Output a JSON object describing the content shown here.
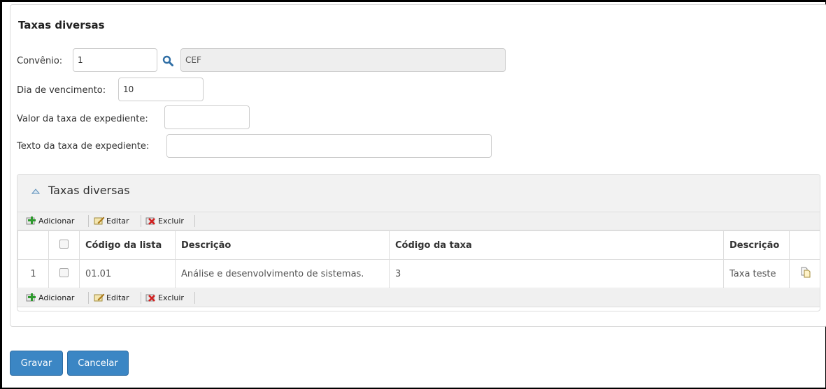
{
  "form": {
    "title": "Taxas diversas",
    "convenio_label": "Convênio:",
    "convenio_value": "1",
    "convenio_name": "CEF",
    "dia_label": "Dia de vencimento:",
    "dia_value": "10",
    "valor_label": "Valor da taxa de expediente:",
    "valor_value": "",
    "texto_label": "Texto da taxa de expediente:",
    "texto_value": ""
  },
  "grid": {
    "title": "Taxas diversas",
    "toolbar": {
      "add": "Adicionar",
      "edit": "Editar",
      "delete": "Excluir"
    },
    "columns": [
      "",
      "",
      "Código da lista",
      "Descrição",
      "Código da taxa",
      "Descrição",
      ""
    ],
    "rows": [
      {
        "num": "1",
        "codigo_lista": "01.01",
        "descricao": "Análise e desenvolvimento de sistemas.",
        "codigo_taxa": "3",
        "descricao_taxa": "Taxa teste"
      }
    ]
  },
  "actions": {
    "save": "Gravar",
    "cancel": "Cancelar"
  },
  "colors": {
    "primary": "#3b86c4",
    "header_bg": "#f2f2f2"
  }
}
